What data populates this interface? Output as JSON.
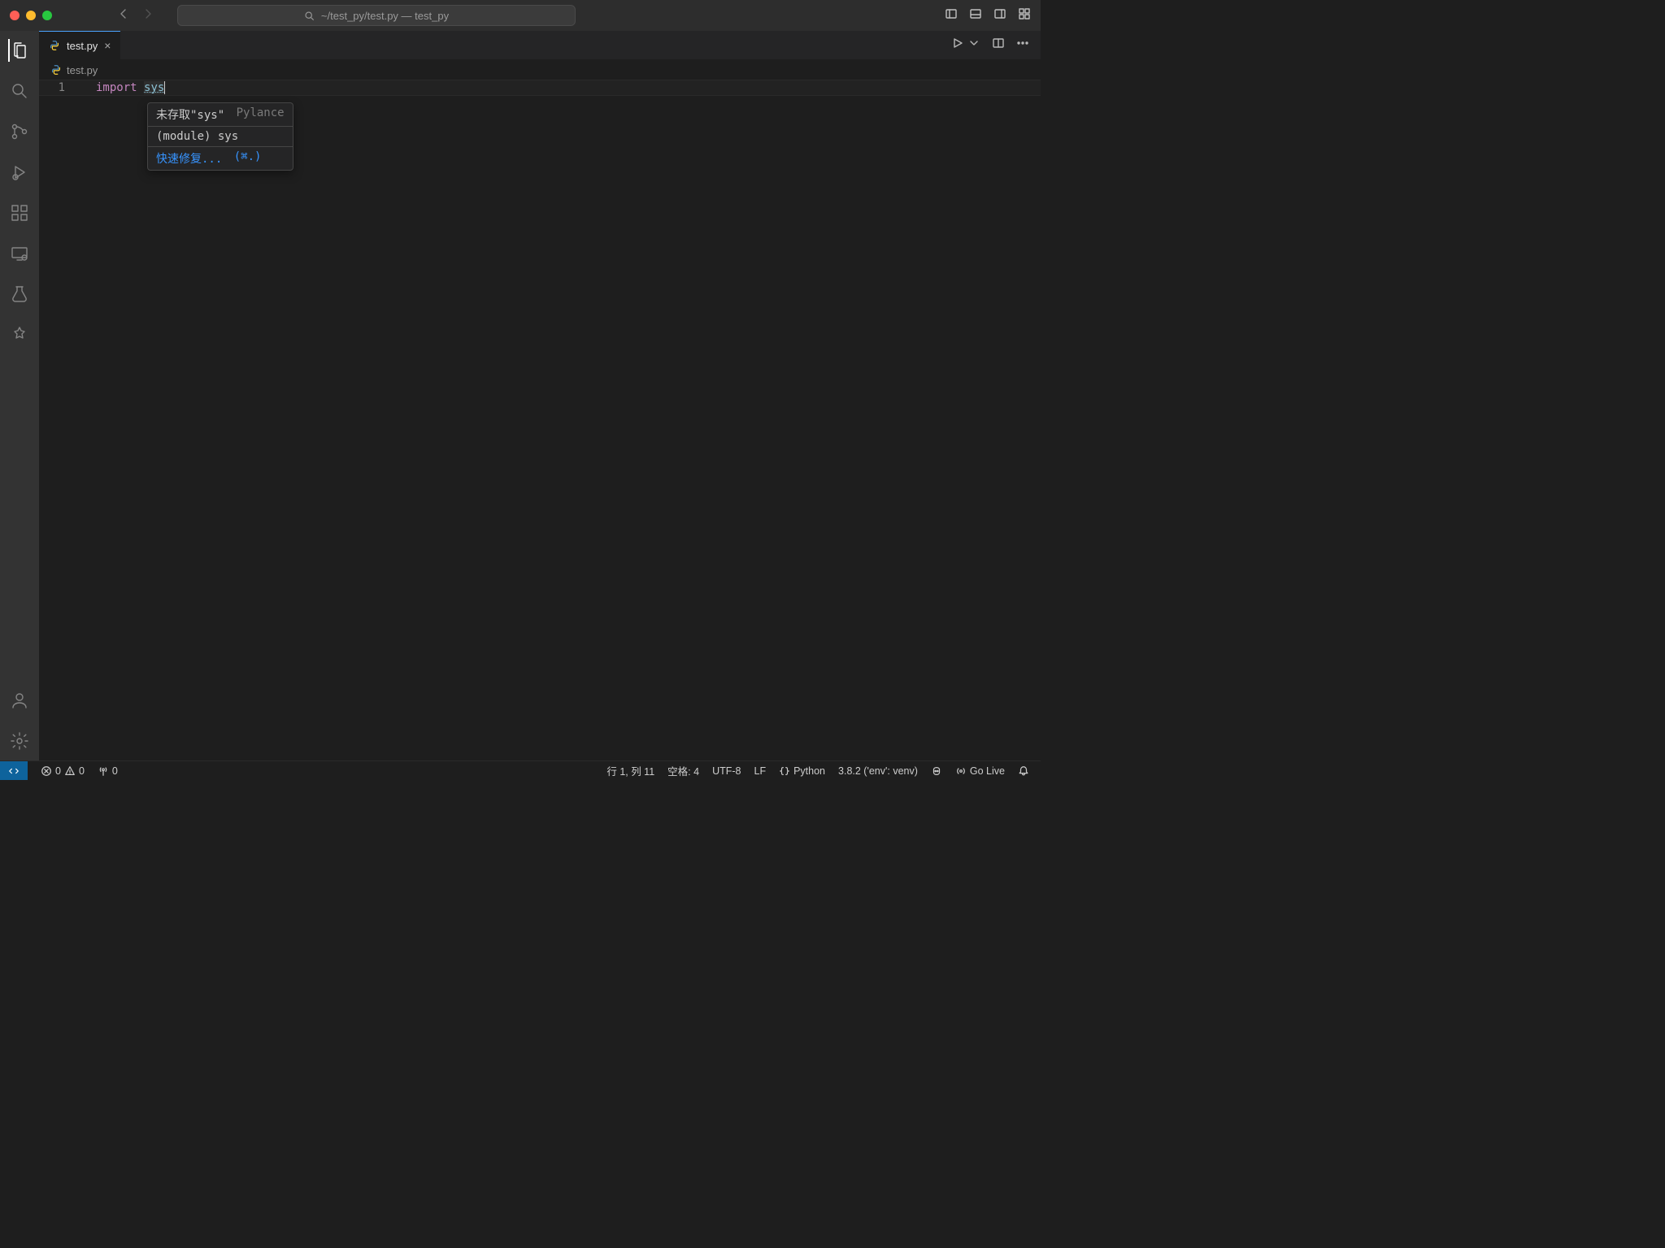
{
  "title_bar": {
    "path": "~/test_py/test.py — test_py"
  },
  "tabs": {
    "active": {
      "filename": "test.py"
    }
  },
  "breadcrumbs": {
    "file": "test.py"
  },
  "editor": {
    "line_number": "1",
    "keyword_import": "import ",
    "module_sys": "sys"
  },
  "hover": {
    "line1_prefix": "未存取\"sys\"",
    "line1_source": " Pylance",
    "line2": "(module) sys",
    "line3_label": "快速修复... ",
    "line3_shortcut": "(⌘.)"
  },
  "status": {
    "errors": "0",
    "warnings": "0",
    "ports": "0",
    "cursor": "行 1, 列 11",
    "spaces": "空格: 4",
    "encoding": "UTF-8",
    "eol": "LF",
    "language": "Python",
    "interpreter": "3.8.2 ('env': venv)",
    "golive": "Go Live"
  }
}
